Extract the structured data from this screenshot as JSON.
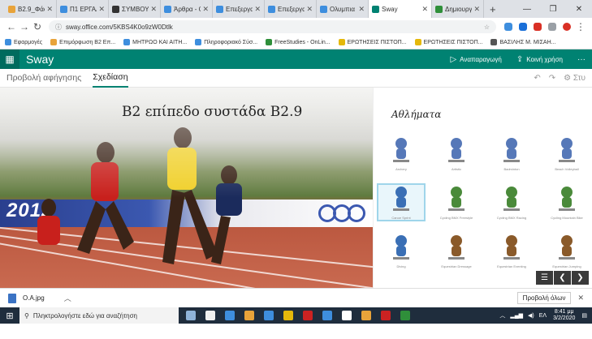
{
  "browser": {
    "tabs": [
      {
        "label": "B2.9_Φάση",
        "color": "#e8a33a"
      },
      {
        "label": "Π1 ΕΡΓΑΛΕ",
        "color": "#3e8ede"
      },
      {
        "label": "ΣΥΜΒΟΥΛ",
        "color": "#333333"
      },
      {
        "label": "Άρθρα - Οί",
        "color": "#3e8ede"
      },
      {
        "label": "Επεξεργασ",
        "color": "#3e8ede"
      },
      {
        "label": "Επεξεργασ",
        "color": "#3e8ede"
      },
      {
        "label": "Ολυμπια Τ",
        "color": "#3e8ede"
      },
      {
        "label": "Sway",
        "color": "#008272"
      },
      {
        "label": "Δημιουργί",
        "color": "#2f8f3a"
      }
    ],
    "new_tab": "+",
    "url": "sway.office.com/5KBS4K0o9zW0Dtlk",
    "bookmarks": [
      {
        "label": "Εφαρμογές",
        "color": "#3e8ede"
      },
      {
        "label": "Επιμόρφωση Β2 Επ...",
        "color": "#e8a33a"
      },
      {
        "label": "ΜΗΤΡΩΟ ΚΑΙ ΑΙΤΗ...",
        "color": "#3e8ede"
      },
      {
        "label": "Πληροφοριακό Σύσ...",
        "color": "#3e8ede"
      },
      {
        "label": "FreeStudies - OnLin...",
        "color": "#2f8f3a"
      },
      {
        "label": "ΕΡΩΤΗΣΕΙΣ ΠΙΣΤΟΠ...",
        "color": "#e5b80b"
      },
      {
        "label": "ΕΡΩΤΗΣΕΙΣ ΠΙΣΤΟΠ...",
        "color": "#e5b80b"
      },
      {
        "label": "ΒΑΣΙΛΗΣ Μ. ΜΙΣΑΗ...",
        "color": "#555555"
      }
    ]
  },
  "sway": {
    "app_name": "Sway",
    "play_label": "Αναπαραγωγή",
    "share_label": "Κοινή χρήση",
    "more": "···",
    "tabs": [
      "Προβολή αφήγησης",
      "Σχεδίαση"
    ],
    "right_tools": [
      "↶",
      "↷",
      "⚙ Στυ"
    ],
    "title": "Β2 επίπεδο συστάδα Β2.9",
    "year_text": "2012",
    "gallery_title": "Αθλήματα",
    "gallery_items": [
      {
        "caption": "Archery",
        "color": "#5678b8"
      },
      {
        "caption": "Artistic",
        "color": "#5678b8"
      },
      {
        "caption": "Badminton",
        "color": "#5678b8"
      },
      {
        "caption": "Beach Volleyball",
        "color": "#5678b8"
      },
      {
        "caption": "Canoe Sprint",
        "color": "#3a6fb5"
      },
      {
        "caption": "Cycling BMX Freestyle",
        "color": "#4a8a3a"
      },
      {
        "caption": "Cycling BMX Racing",
        "color": "#4a8a3a"
      },
      {
        "caption": "Cycling Mountain Bike",
        "color": "#4a8a3a"
      },
      {
        "caption": "Diving",
        "color": "#3a6fb5"
      },
      {
        "caption": "Equestrian Dressage",
        "color": "#8a5a2a"
      },
      {
        "caption": "Equestrian Eventing",
        "color": "#8a5a2a"
      },
      {
        "caption": "Equestrian Jumping",
        "color": "#8a5a2a"
      }
    ],
    "pager": [
      "☰",
      "❮",
      "❯"
    ]
  },
  "download": {
    "file": "O.A.jpg",
    "show_all": "Προβολή όλων",
    "close": "✕"
  },
  "taskbar": {
    "search_placeholder": "Πληκτρολογήστε εδώ για αναζήτηση",
    "time": "8:41 μμ",
    "date": "3/2/2020",
    "lang": "ΕΛ",
    "apps": [
      "#8fb3d9",
      "#f0f0f0",
      "#3e8ede",
      "#e8a33a",
      "#3e8ede",
      "#e5b80b",
      "#cc2222",
      "#3e8ede",
      "#ffffff",
      "#e8a33a",
      "#cc2222",
      "#2f8f3a"
    ]
  }
}
